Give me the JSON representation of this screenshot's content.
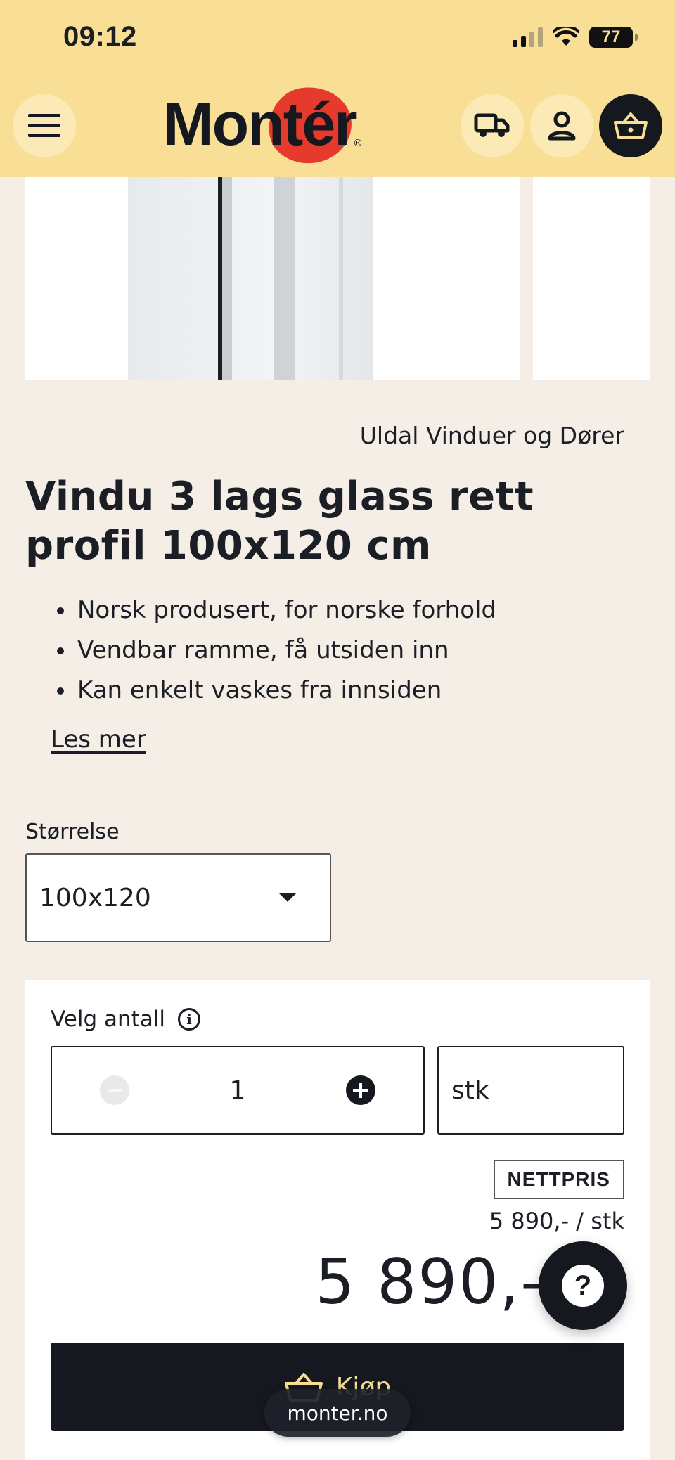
{
  "status_bar": {
    "time": "09:12",
    "battery": "77"
  },
  "header": {
    "logo_text": "Montér",
    "icons": [
      "menu-icon",
      "truck-icon",
      "user-icon",
      "basket-icon"
    ]
  },
  "product": {
    "brand": "Uldal Vinduer og Dører",
    "title": "Vindu 3 lags glass rett profil 100x120 cm",
    "bullets": [
      "Norsk produsert, for norske forhold",
      "Vendbar ramme, få utsiden inn",
      "Kan enkelt vaskes fra innsiden"
    ],
    "read_more": "Les mer"
  },
  "size": {
    "label": "Størrelse",
    "selected": "100x120"
  },
  "purchase": {
    "quantity_label": "Velg antall",
    "quantity": "1",
    "unit": "stk",
    "net_badge": "NETTPRIS",
    "unit_price": "5 890,- / stk",
    "total_price": "5 890,-",
    "buy_label": "Kjøp"
  },
  "browser": {
    "url": "monter.no"
  },
  "colors": {
    "header_bg": "#f8df95",
    "page_bg": "#f4eee6",
    "dark": "#15181f",
    "logo_red": "#e63a2c"
  }
}
